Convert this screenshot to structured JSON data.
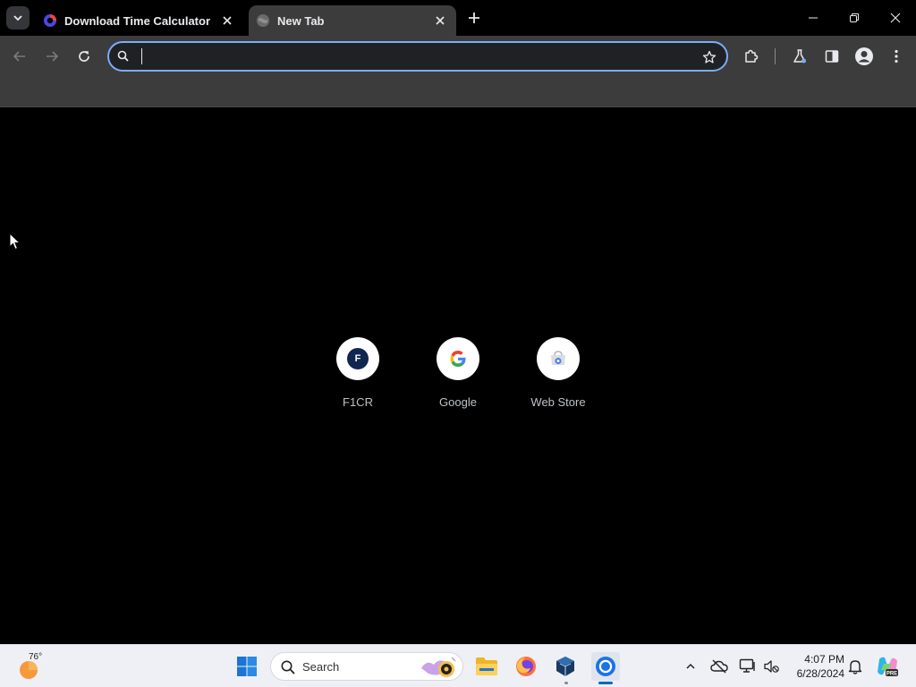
{
  "browser": {
    "tabs": [
      {
        "title": "Download Time Calculator",
        "active": false
      },
      {
        "title": "New Tab",
        "active": true
      }
    ],
    "omnibox": {
      "value": "",
      "placeholder": ""
    }
  },
  "new_tab_page": {
    "shortcuts": [
      {
        "label": "F1CR",
        "badge": "F"
      },
      {
        "label": "Google",
        "badge": "G"
      },
      {
        "label": "Web Store",
        "badge": ""
      }
    ]
  },
  "taskbar": {
    "weather_temp": "76°",
    "search_label": "Search",
    "clock_time": "4:07 PM",
    "clock_date": "6/28/2024",
    "copilot_badge": "PRE"
  },
  "colors": {
    "toolbar": "#3c3c3c",
    "omnibox_border": "#7cacf8",
    "taskbar": "#eef0f6",
    "accent": "#0067c0"
  }
}
